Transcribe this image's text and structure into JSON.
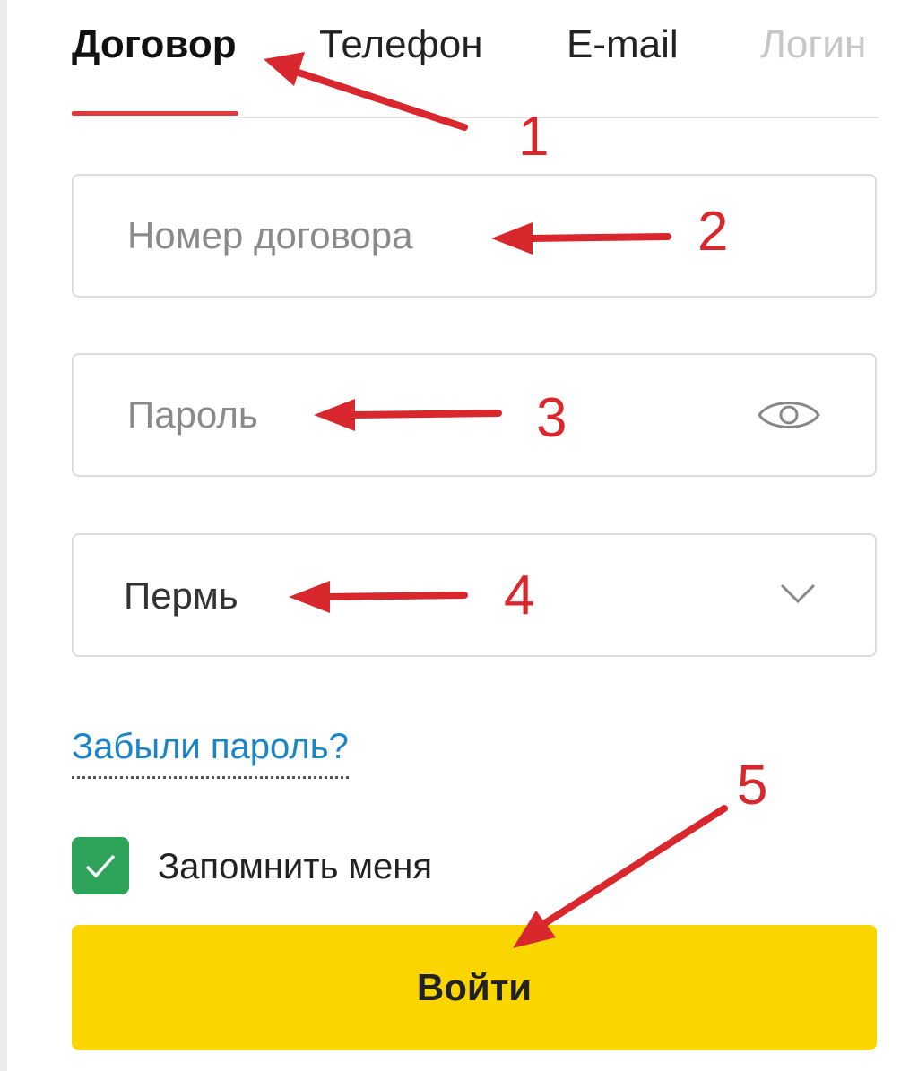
{
  "tabs": [
    {
      "label": "Договор",
      "active": true
    },
    {
      "label": "Телефон",
      "active": false
    },
    {
      "label": "E-mail",
      "active": false
    },
    {
      "label": "Логин",
      "active": false
    }
  ],
  "form": {
    "contract_placeholder": "Номер договора",
    "password_placeholder": "Пароль",
    "city_selected": "Пермь",
    "forgot_link": "Забыли пароль?",
    "remember_label": "Запомнить меня",
    "remember_checked": true,
    "submit_label": "Войти"
  },
  "icons": {
    "password_toggle": "eye-icon",
    "city_dropdown": "chevron-down-icon",
    "remember": "check-icon"
  },
  "annotations": [
    "1",
    "2",
    "3",
    "4",
    "5"
  ],
  "colors": {
    "accent_red": "#e0383c",
    "annotation_red": "#d9282d",
    "link_blue": "#1a86c8",
    "checkbox_green": "#2ea45a",
    "button_yellow": "#fad500"
  }
}
